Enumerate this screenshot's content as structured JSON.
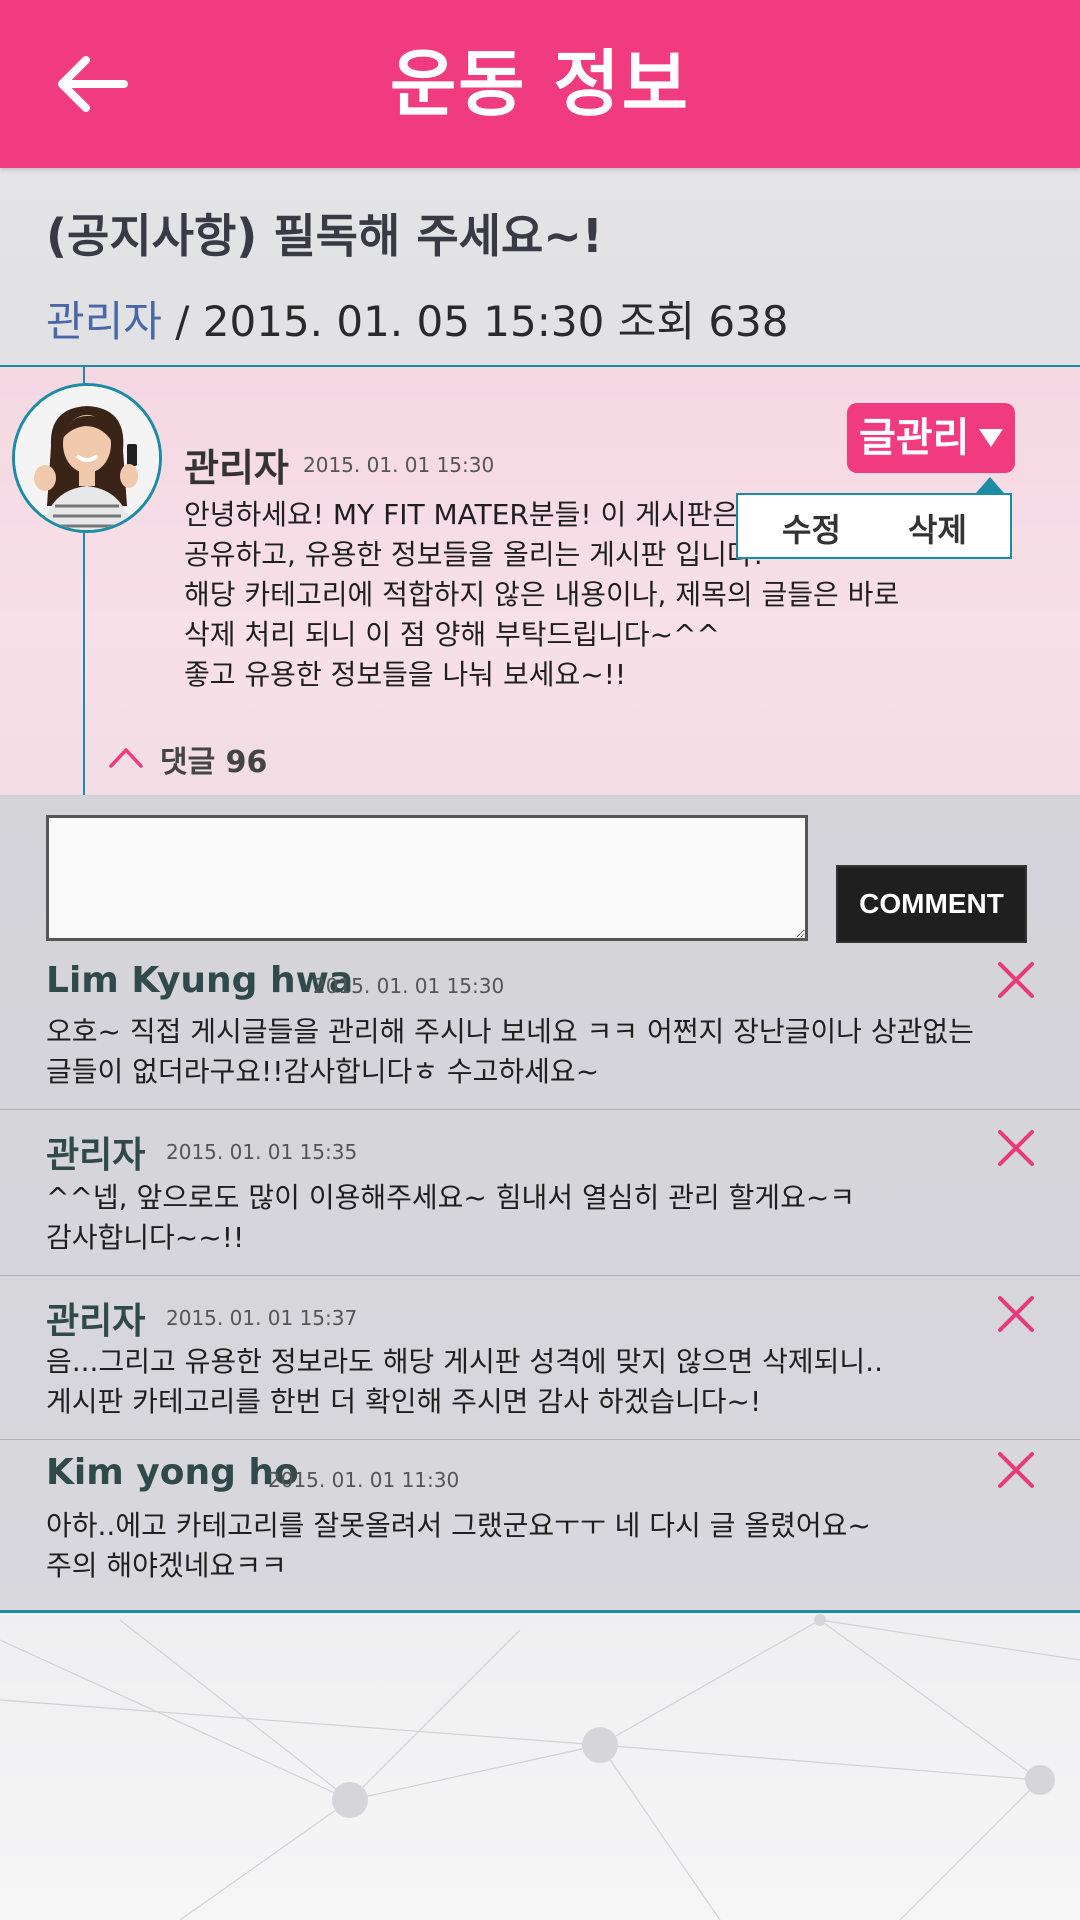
{
  "header": {
    "title": "운동 정보"
  },
  "post": {
    "title": "(공지사항) 필독해 주세요~!",
    "meta_author": "관리자",
    "meta_rest": " / 2015. 01. 05 15:30 조회 638",
    "author": "관리자",
    "date": "2015. 01. 01 15:30",
    "body": "안녕하세요! MY FIT MATER분들! 이 게시판은 운동 정보를\n공유하고, 유용한 정보들을 올리는 게시판 입니다!\n해당 카테고리에 적합하지 않은 내용이나, 제목의 글들은 바로\n삭제 처리 되니 이 점 양해 부탁드립니다~^^\n좋고 유용한 정보들을 나눠 보세요~!!",
    "manage_label": "글관리",
    "menu": {
      "edit": "수정",
      "delete": "삭제"
    },
    "reply_label": "댓글 96"
  },
  "comment_form": {
    "input_value": "",
    "button_label": "COMMENT"
  },
  "comments": [
    {
      "name": "Lim Kyung hwa",
      "date": "2015. 01. 01 15:30",
      "text": "오호~ 직접 게시글들을 관리해 주시나 보네요 ㅋㅋ 어쩐지 장난글이나 상관없는\n글들이 없더라구요!!감사합니다ㅎ 수고하세요~"
    },
    {
      "name": "관리자",
      "date": "2015. 01. 01 15:35",
      "text": "^^넵, 앞으로도 많이 이용해주세요~ 힘내서 열심히 관리 할게요~ㅋ\n감사합니다~~!!"
    },
    {
      "name": "관리자",
      "date": "2015. 01. 01 15:37",
      "text": "음...그리고 유용한 정보라도 해당 게시판 성격에 맞지 않으면 삭제되니..\n게시판 카테고리를 한번 더 확인해 주시면 감사 하겠습니다~!"
    },
    {
      "name": "Kim yong ho",
      "date": "2015. 01. 01 11:30",
      "text": "아하..에고 카테고리를 잘못올려서 그랬군요ㅜㅜ 네 다시 글 올렸어요~\n주의 해야겠네요ㅋㅋ"
    }
  ],
  "colors": {
    "accent": "#f03c7e",
    "line": "#1b8ba6",
    "author_blue": "#4a67a8"
  }
}
